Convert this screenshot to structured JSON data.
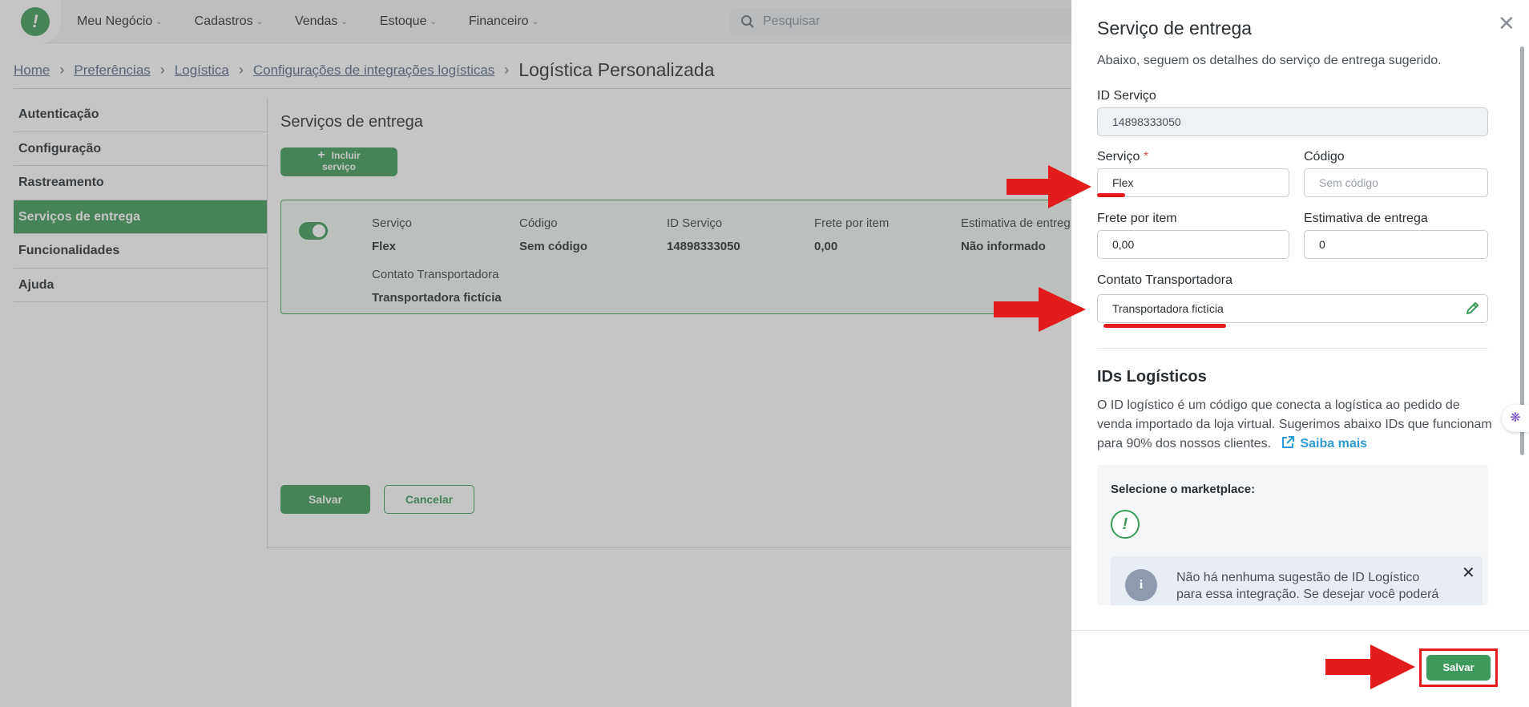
{
  "topbar": {
    "logo_glyph": "!",
    "nav": [
      {
        "label": "Meu Negócio"
      },
      {
        "label": "Cadastros"
      },
      {
        "label": "Vendas"
      },
      {
        "label": "Estoque"
      },
      {
        "label": "Financeiro"
      }
    ],
    "search_placeholder": "Pesquisar"
  },
  "breadcrumb": {
    "links": [
      "Home",
      "Preferências",
      "Logística",
      "Configurações de integrações logísticas"
    ],
    "current": "Logística Personalizada"
  },
  "sidebar": {
    "items": [
      {
        "label": "Autenticação",
        "active": false
      },
      {
        "label": "Configuração",
        "active": false
      },
      {
        "label": "Rastreamento",
        "active": false
      },
      {
        "label": "Serviços de entrega",
        "active": true
      },
      {
        "label": "Funcionalidades",
        "active": false
      },
      {
        "label": "Ajuda",
        "active": false
      }
    ]
  },
  "main": {
    "section_title": "Serviços de entrega",
    "add_button": {
      "plus": "+",
      "line1": "Incluir",
      "line2": "serviço"
    },
    "card": {
      "enabled": true,
      "servico_label": "Serviço",
      "servico_value": "Flex",
      "codigo_label": "Código",
      "codigo_value": "Sem código",
      "id_label": "ID Serviço",
      "id_value": "14898333050",
      "frete_label": "Frete por item",
      "frete_value": "0,00",
      "estimativa_label": "Estimativa de entreg",
      "estimativa_value": "Não informado",
      "contato_label": "Contato Transportadora",
      "contato_value": "Transportadora fictícia"
    },
    "save_label": "Salvar",
    "cancel_label": "Cancelar"
  },
  "drawer": {
    "title": "Serviço de entrega",
    "close_glyph": "✕",
    "subtitle": "Abaixo, seguem os detalhes do serviço de entrega sugerido.",
    "fields": {
      "id_label": "ID Serviço",
      "id_value": "14898333050",
      "servico_label": "Serviço",
      "servico_required": "*",
      "servico_value": "Flex",
      "codigo_label": "Código",
      "codigo_placeholder": "Sem código",
      "frete_label": "Frete por item",
      "frete_value": "0,00",
      "estimativa_label": "Estimativa de entrega",
      "estimativa_value": "0",
      "contato_label": "Contato Transportadora",
      "contato_value": "Transportadora fictícia"
    },
    "ids_title": "IDs Logísticos",
    "ids_text": "O ID logístico é um código que conecta a logística ao pedido de venda importado da loja virtual. Sugerimos abaixo IDs que funcionam para 90% dos nossos clientes.",
    "saiba_label": "Saiba mais",
    "marketplace_label": "Selecione o marketplace:",
    "marketplace_logo_glyph": "!",
    "alert_icon_glyph": "i",
    "alert_text": "Não há nenhuma sugestão de ID Logístico para essa integração. Se desejar você poderá",
    "alert_close_glyph": "✕",
    "save_label": "Salvar"
  },
  "colors": {
    "brand_green": "#3d9a5a",
    "annotation_red": "#e31b1b",
    "link_blue": "#2d9bd6"
  }
}
